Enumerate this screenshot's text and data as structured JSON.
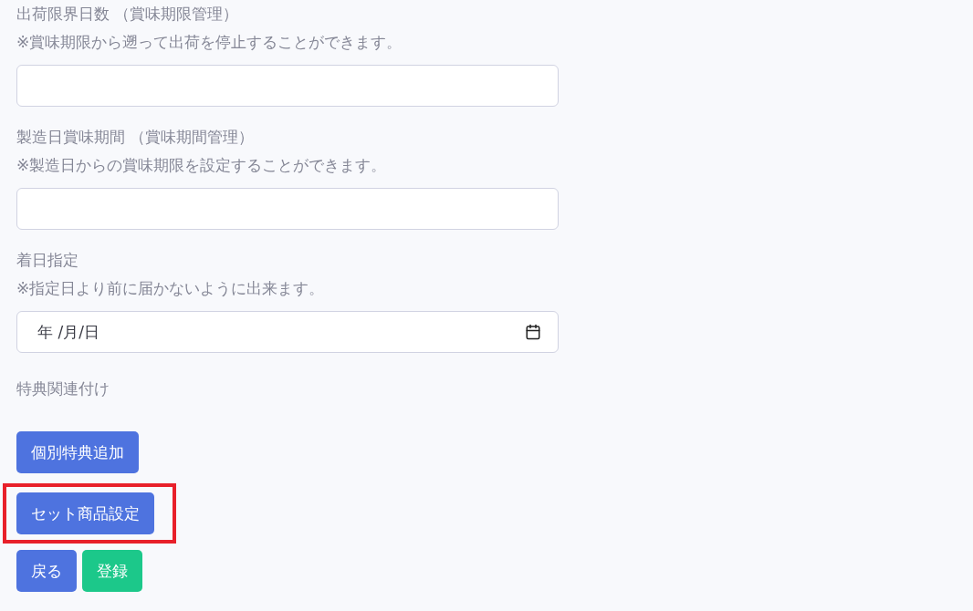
{
  "fields": [
    {
      "kind": "text",
      "label": "出荷限界日数 （賞味期限管理）",
      "note": "※賞味期限から遡って出荷を停止することができます。"
    },
    {
      "kind": "text",
      "label": "製造日賞味期間 （賞味期間管理）",
      "note": "※製造日からの賞味期限を設定することができます。"
    },
    {
      "kind": "date",
      "label": "着日指定",
      "note": "※指定日より前に届かないように出来ます。",
      "value": "年 /月/日"
    }
  ],
  "section_label": "特典関連付け",
  "buttons": [
    {
      "label": "個別特典追加",
      "color": "#4e73df",
      "highlighted": false
    },
    {
      "label": "セット商品設定",
      "color": "#4e73df",
      "highlighted": true
    }
  ],
  "footer_buttons": [
    {
      "label": "戻る",
      "color": "#4e73df"
    },
    {
      "label": "登録",
      "color": "#1cc88a"
    }
  ]
}
